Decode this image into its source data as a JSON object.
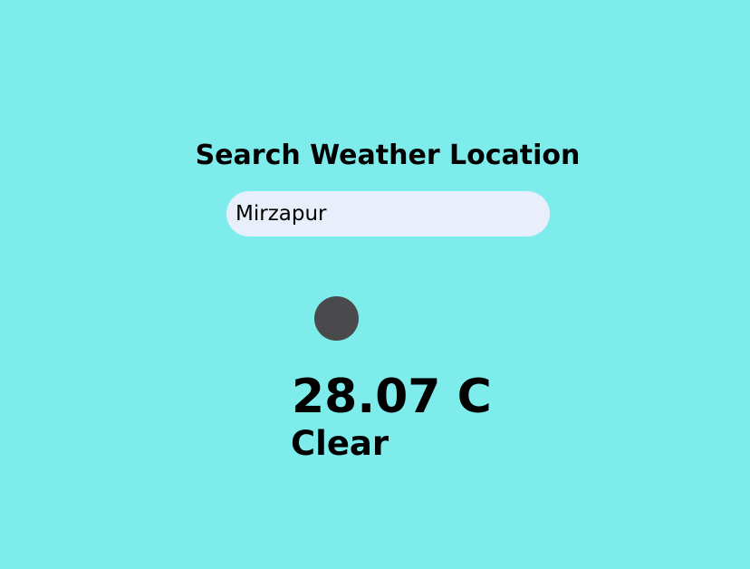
{
  "search": {
    "heading": "Search Weather Location",
    "value": "Mirzapur",
    "placeholder": ""
  },
  "weather": {
    "icon": "weather-condition-icon",
    "temperature": "28.07 C",
    "condition": "Clear"
  },
  "colors": {
    "background": "#7eeceb",
    "input_background": "#e8effa",
    "icon_color": "#4a4a4d",
    "text": "#000000"
  }
}
